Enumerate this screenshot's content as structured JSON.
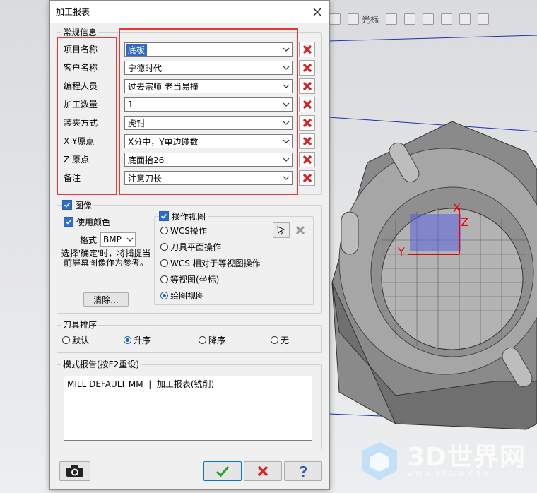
{
  "background": {
    "toolbar_label": "光标",
    "watermark_text": "3D世界网",
    "watermark_sub": "WWW.3DSJW.COM"
  },
  "dialog": {
    "title": "加工报表",
    "general": {
      "legend": "常规信息",
      "fields": [
        {
          "label": "项目名称",
          "value": "底板"
        },
        {
          "label": "客户名称",
          "value": "宁德时代"
        },
        {
          "label": "编程人员",
          "value": "过去宗师 老当易撞"
        },
        {
          "label": "加工数量",
          "value": "1"
        },
        {
          "label": "装夹方式",
          "value": "虎钳"
        },
        {
          "label": "X Y原点",
          "value": "X分中，Y单边碰数"
        },
        {
          "label": "Z 原点",
          "value": "底面抬26"
        },
        {
          "label": "备注",
          "value": "注意刀长"
        }
      ]
    },
    "image": {
      "label": "图像",
      "use_color": "使用颜色",
      "format_label": "格式",
      "format_value": "BMP",
      "hint": "选择'确定'时，将捕捉当前屏幕图像作为参考。",
      "clear_button": "清除..."
    },
    "view": {
      "label": "操作视图",
      "options": [
        "WCS操作",
        "刀具平面操作",
        "WCS 相对于等视图操作",
        "等视图(坐标)",
        "绘图视图"
      ],
      "selected": 4
    },
    "sort": {
      "legend": "刀具排序",
      "options": [
        "默认",
        "升序",
        "降序",
        "无"
      ],
      "selected": 1
    },
    "report": {
      "legend": "模式报告(按F2重设)",
      "text": "MILL DEFAULT MM  |  加工报表(铣削)"
    }
  },
  "colors": {
    "highlight_red": "#e53935",
    "selection_blue": "#3169c6",
    "ok_green": "#2e9e2e",
    "cancel_red": "#e02020",
    "help_blue": "#2a5db0"
  }
}
